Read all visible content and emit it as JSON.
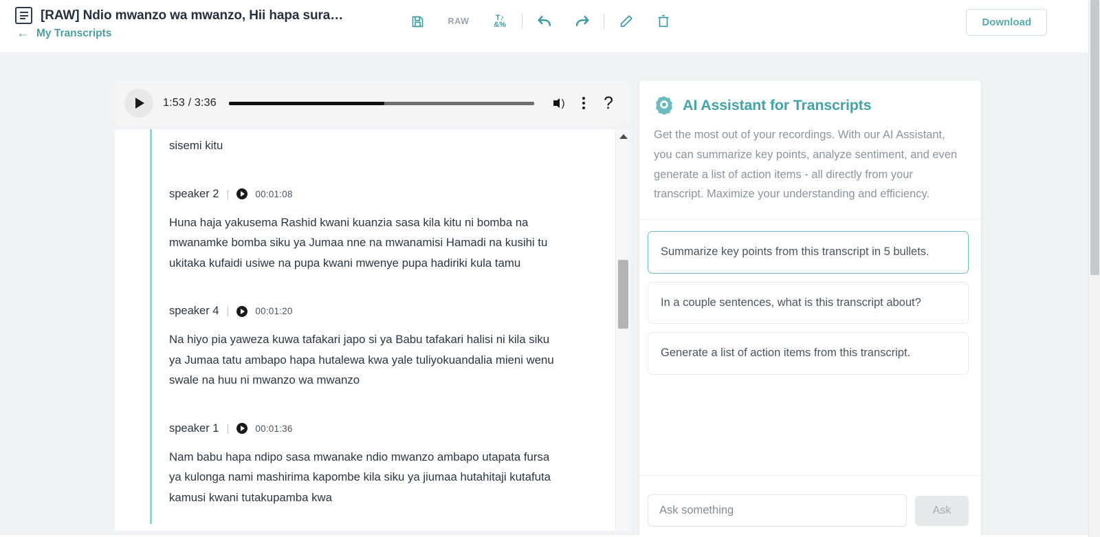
{
  "header": {
    "doc_icon": "document-icon",
    "title": "[RAW] Ndio mwanzo wa mwanzo, Hii hapa sura…",
    "back_arrow": "←",
    "back_label": "My Transcripts",
    "toolbar": {
      "save_icon": "save-icon",
      "raw_label": "RAW",
      "symbols_icon": "special-characters-icon",
      "undo_icon": "undo-icon",
      "redo_icon": "redo-icon",
      "edit_icon": "pencil-icon",
      "delete_icon": "trash-icon"
    },
    "download_label": "Download"
  },
  "player": {
    "play_icon": "play-icon",
    "time": "1:53 / 3:36",
    "current_time": "1:53",
    "duration": "3:36",
    "progress_percent": 51,
    "volume_icon": "volume-icon",
    "more_icon": "more-vertical-icon",
    "help_icon": "question-mark-icon"
  },
  "transcript": {
    "segments": [
      {
        "speaker": "",
        "timestamp": "",
        "text": "sisemi kitu",
        "partial": true
      },
      {
        "speaker": "speaker 2",
        "timestamp": "00:01:08",
        "text": "Huna haja yakusema Rashid kwani kuanzia sasa kila kitu ni bomba na mwanamke bomba siku ya Jumaa nne na mwanamisi Hamadi na kusihi tu ukitaka kufaidi usiwe na pupa kwani mwenye pupa hadiriki kula tamu",
        "partial": false
      },
      {
        "speaker": "speaker 4",
        "timestamp": "00:01:20",
        "text": "Na hiyo pia yaweza kuwa tafakari japo si ya Babu tafakari halisi ni kila siku ya Jumaa tatu ambapo hapa hutalewa kwa yale tuliyokuandalia mieni wenu swale na huu ni mwanzo wa mwanzo",
        "partial": false
      },
      {
        "speaker": "speaker 1",
        "timestamp": "00:01:36",
        "text": "Nam babu hapa ndipo sasa mwanake ndio mwanzo ambapo utapata fursa ya kulonga nami mashirima kapombe kila siku ya jiumaa hutahitaji kutafuta kamusi kwani tutakupamba kwa",
        "partial": false
      }
    ],
    "separator": "|",
    "scroll_up_icon": "scroll-up-arrow-icon"
  },
  "ai_panel": {
    "logo_icon": "ai-assistant-logo-icon",
    "title": "AI Assistant for Transcripts",
    "description": "Get the most out of your recordings. With our AI Assistant, you can summarize key points, analyze sentiment, and even generate a list of action items - all directly from your transcript. Maximize your understanding and efficiency.",
    "suggestions": [
      {
        "text": "Summarize key points from this transcript in 5 bullets.",
        "active": true
      },
      {
        "text": "In a couple sentences, what is this transcript about?",
        "active": false
      },
      {
        "text": "Generate a list of action items from this transcript.",
        "active": false
      }
    ],
    "ask_placeholder": "Ask something",
    "ask_value": "",
    "ask_button_label": "Ask"
  },
  "colors": {
    "accent_teal": "#44a4a8",
    "link_teal": "#4e9ea0",
    "speaker_bar": "#9cd0d6",
    "page_bg": "#f1f2f4",
    "card_border_active": "#6dbdc0",
    "muted_text": "#8b949d"
  }
}
